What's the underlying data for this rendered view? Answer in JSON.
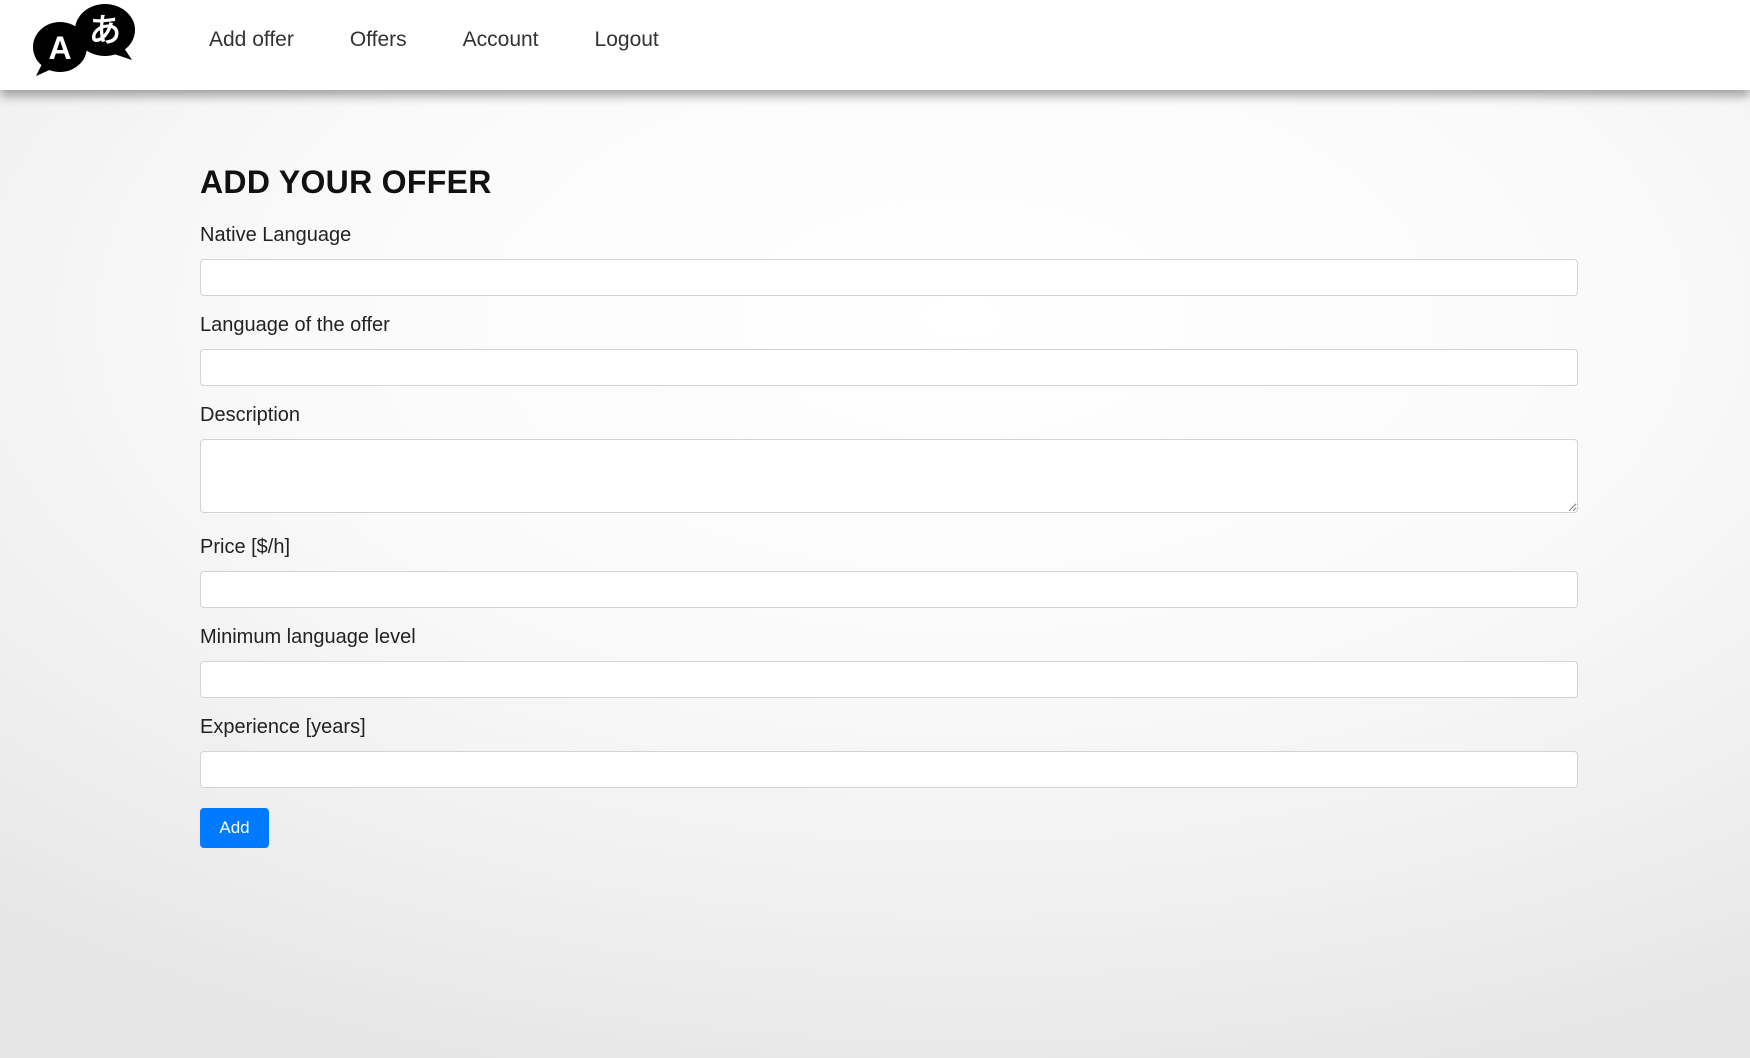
{
  "header": {
    "logo_icon": "translate-speech-bubbles-icon",
    "logo_glyph_left": "A",
    "logo_glyph_right": "あ",
    "nav": [
      {
        "label": "Add offer"
      },
      {
        "label": "Offers"
      },
      {
        "label": "Account"
      },
      {
        "label": "Logout"
      }
    ]
  },
  "form": {
    "title": "ADD YOUR OFFER",
    "fields": {
      "native_language": {
        "label": "Native Language",
        "value": ""
      },
      "offer_language": {
        "label": "Language of the offer",
        "value": ""
      },
      "description": {
        "label": "Description",
        "value": ""
      },
      "price": {
        "label": "Price [$/h]",
        "value": ""
      },
      "min_level": {
        "label": "Minimum language level",
        "value": ""
      },
      "experience": {
        "label": "Experience [years]",
        "value": ""
      }
    },
    "submit_label": "Add"
  },
  "colors": {
    "accent": "#007bff",
    "nav_text": "#333333",
    "title_text": "#111111"
  }
}
